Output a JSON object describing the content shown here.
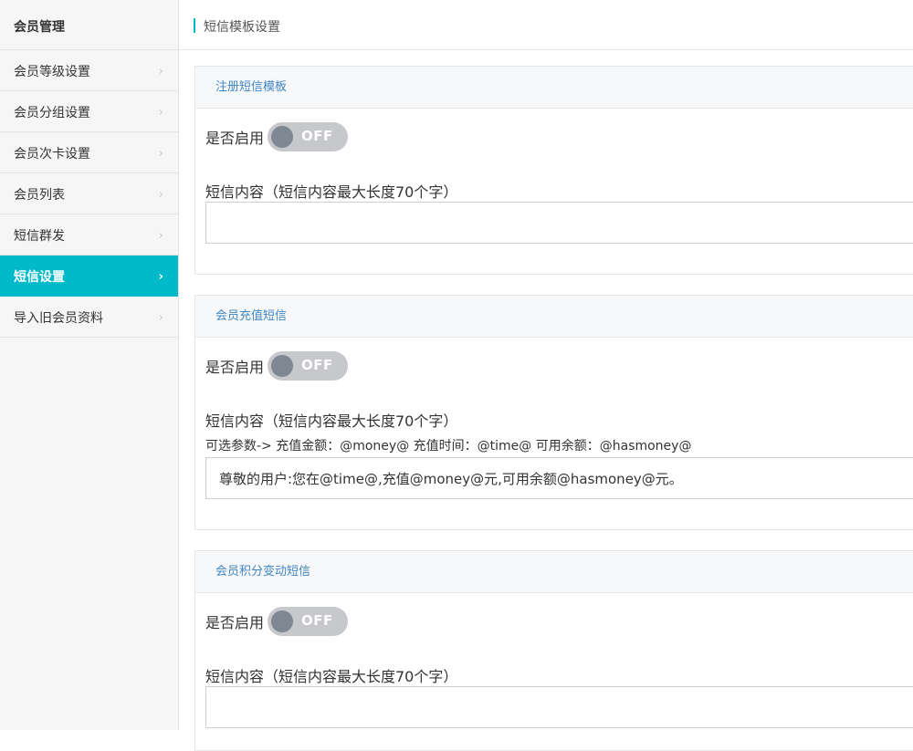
{
  "sidebar": {
    "title": "会员管理",
    "items": [
      {
        "label": "会员等级设置",
        "chevron": "›"
      },
      {
        "label": "会员分组设置",
        "chevron": "›"
      },
      {
        "label": "会员次卡设置",
        "chevron": "›"
      },
      {
        "label": "会员列表",
        "chevron": "›"
      },
      {
        "label": "短信群发",
        "chevron": "›"
      },
      {
        "label": "短信设置",
        "chevron": "›",
        "active": true
      },
      {
        "label": "导入旧会员资料",
        "chevron": "›"
      }
    ]
  },
  "page": {
    "title": "短信模板设置"
  },
  "panels": [
    {
      "title": "注册短信模板",
      "enable_label": "是否启用",
      "toggle_state": "OFF",
      "content_label": "短信内容（短信内容最大长度70个字）",
      "params": "",
      "content_value": ""
    },
    {
      "title": "会员充值短信",
      "enable_label": "是否启用",
      "toggle_state": "OFF",
      "content_label": "短信内容（短信内容最大长度70个字）",
      "params": "可选参数-> 充值金额：@money@ 充值时间：@time@ 可用余额：@hasmoney@",
      "content_value": "尊敬的用户:您在@time@,充值@money@元,可用余额@hasmoney@元。"
    },
    {
      "title": "会员积分变动短信",
      "enable_label": "是否启用",
      "toggle_state": "OFF",
      "content_label": "短信内容（短信内容最大长度70个字）",
      "params": "",
      "content_value": ""
    }
  ],
  "colors": {
    "accent": "#00b9c9",
    "panel_title": "#3f86c4",
    "toggle_off_bg": "#c6c8cc",
    "toggle_knob": "#7e8792"
  }
}
